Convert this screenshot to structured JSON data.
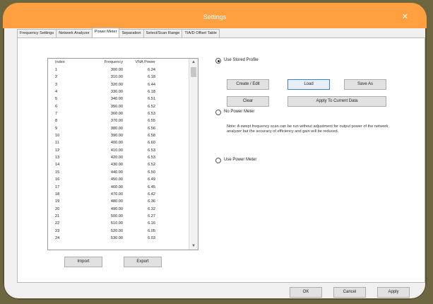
{
  "window": {
    "title": "Settings",
    "close_glyph": "✕"
  },
  "tabs": [
    {
      "label": "Frequency Settings"
    },
    {
      "label": "Network Analyzer"
    },
    {
      "label": "Power Meter"
    },
    {
      "label": "Separation"
    },
    {
      "label": "Select/Scan Range"
    },
    {
      "label": "TIA/D Offset Table"
    }
  ],
  "active_tab": "Power Meter",
  "table": {
    "headers": [
      "Index",
      "Frequency",
      "VNA Power"
    ],
    "rows": [
      [
        "1",
        "300.00",
        "6.24"
      ],
      [
        "2",
        "310.00",
        "6.18"
      ],
      [
        "3",
        "320.00",
        "6.44"
      ],
      [
        "4",
        "330.00",
        "6.18"
      ],
      [
        "5",
        "340.00",
        "6.51"
      ],
      [
        "6",
        "350.00",
        "6.52"
      ],
      [
        "7",
        "360.00",
        "6.53"
      ],
      [
        "8",
        "370.00",
        "6.55"
      ],
      [
        "9",
        "380.00",
        "6.56"
      ],
      [
        "10",
        "390.00",
        "6.58"
      ],
      [
        "11",
        "400.00",
        "6.60"
      ],
      [
        "12",
        "410.00",
        "6.53"
      ],
      [
        "13",
        "420.00",
        "6.53"
      ],
      [
        "14",
        "430.00",
        "6.52"
      ],
      [
        "15",
        "440.00",
        "6.50"
      ],
      [
        "16",
        "450.00",
        "6.49"
      ],
      [
        "17",
        "460.00",
        "6.45"
      ],
      [
        "18",
        "470.00",
        "6.42"
      ],
      [
        "19",
        "480.00",
        "6.36"
      ],
      [
        "20",
        "490.00",
        "6.32"
      ],
      [
        "21",
        "500.00",
        "6.27"
      ],
      [
        "22",
        "510.00",
        "6.16"
      ],
      [
        "23",
        "520.00",
        "6.05"
      ],
      [
        "24",
        "530.00",
        "6.03"
      ]
    ]
  },
  "table_buttons": {
    "import": "Import",
    "export": "Export"
  },
  "options": {
    "stored_profile": "Use Stored Profile",
    "no_power_meter": "No Power Meter",
    "use_power_meter": "Use Power Meter",
    "selected": "stored_profile"
  },
  "profile_buttons": {
    "create_edit": "Create / Edit",
    "load": "Load",
    "save_as": "Save As",
    "clear": "Clear",
    "apply": "Apply To Current Data"
  },
  "note": "Note: A swept frequency scan can be run without adjustment for output power of the network analyzer but the accuracy of efficiency and gain will be reduced.",
  "footer": {
    "ok": "OK",
    "cancel": "Cancel",
    "apply": "Apply"
  }
}
